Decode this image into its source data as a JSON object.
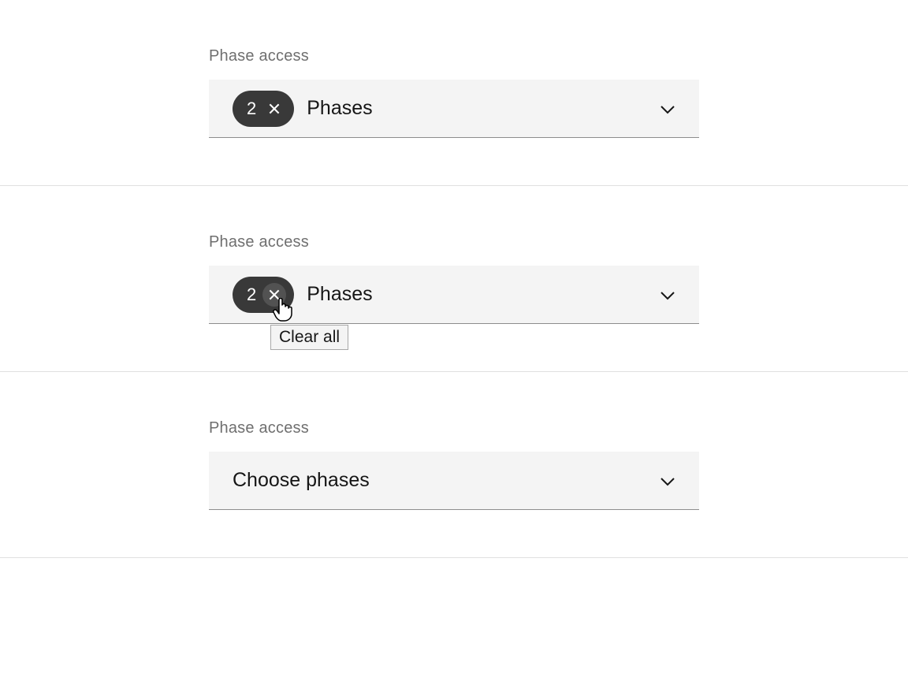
{
  "panels": [
    {
      "label": "Phase access",
      "count": "2",
      "selected_label": "Phases",
      "has_tag": true,
      "hover": false,
      "show_tooltip": false
    },
    {
      "label": "Phase access",
      "count": "2",
      "selected_label": "Phases",
      "has_tag": true,
      "hover": true,
      "show_tooltip": true,
      "tooltip_text": "Clear all"
    },
    {
      "label": "Phase access",
      "placeholder": "Choose phases",
      "has_tag": false,
      "hover": false,
      "show_tooltip": false
    }
  ]
}
